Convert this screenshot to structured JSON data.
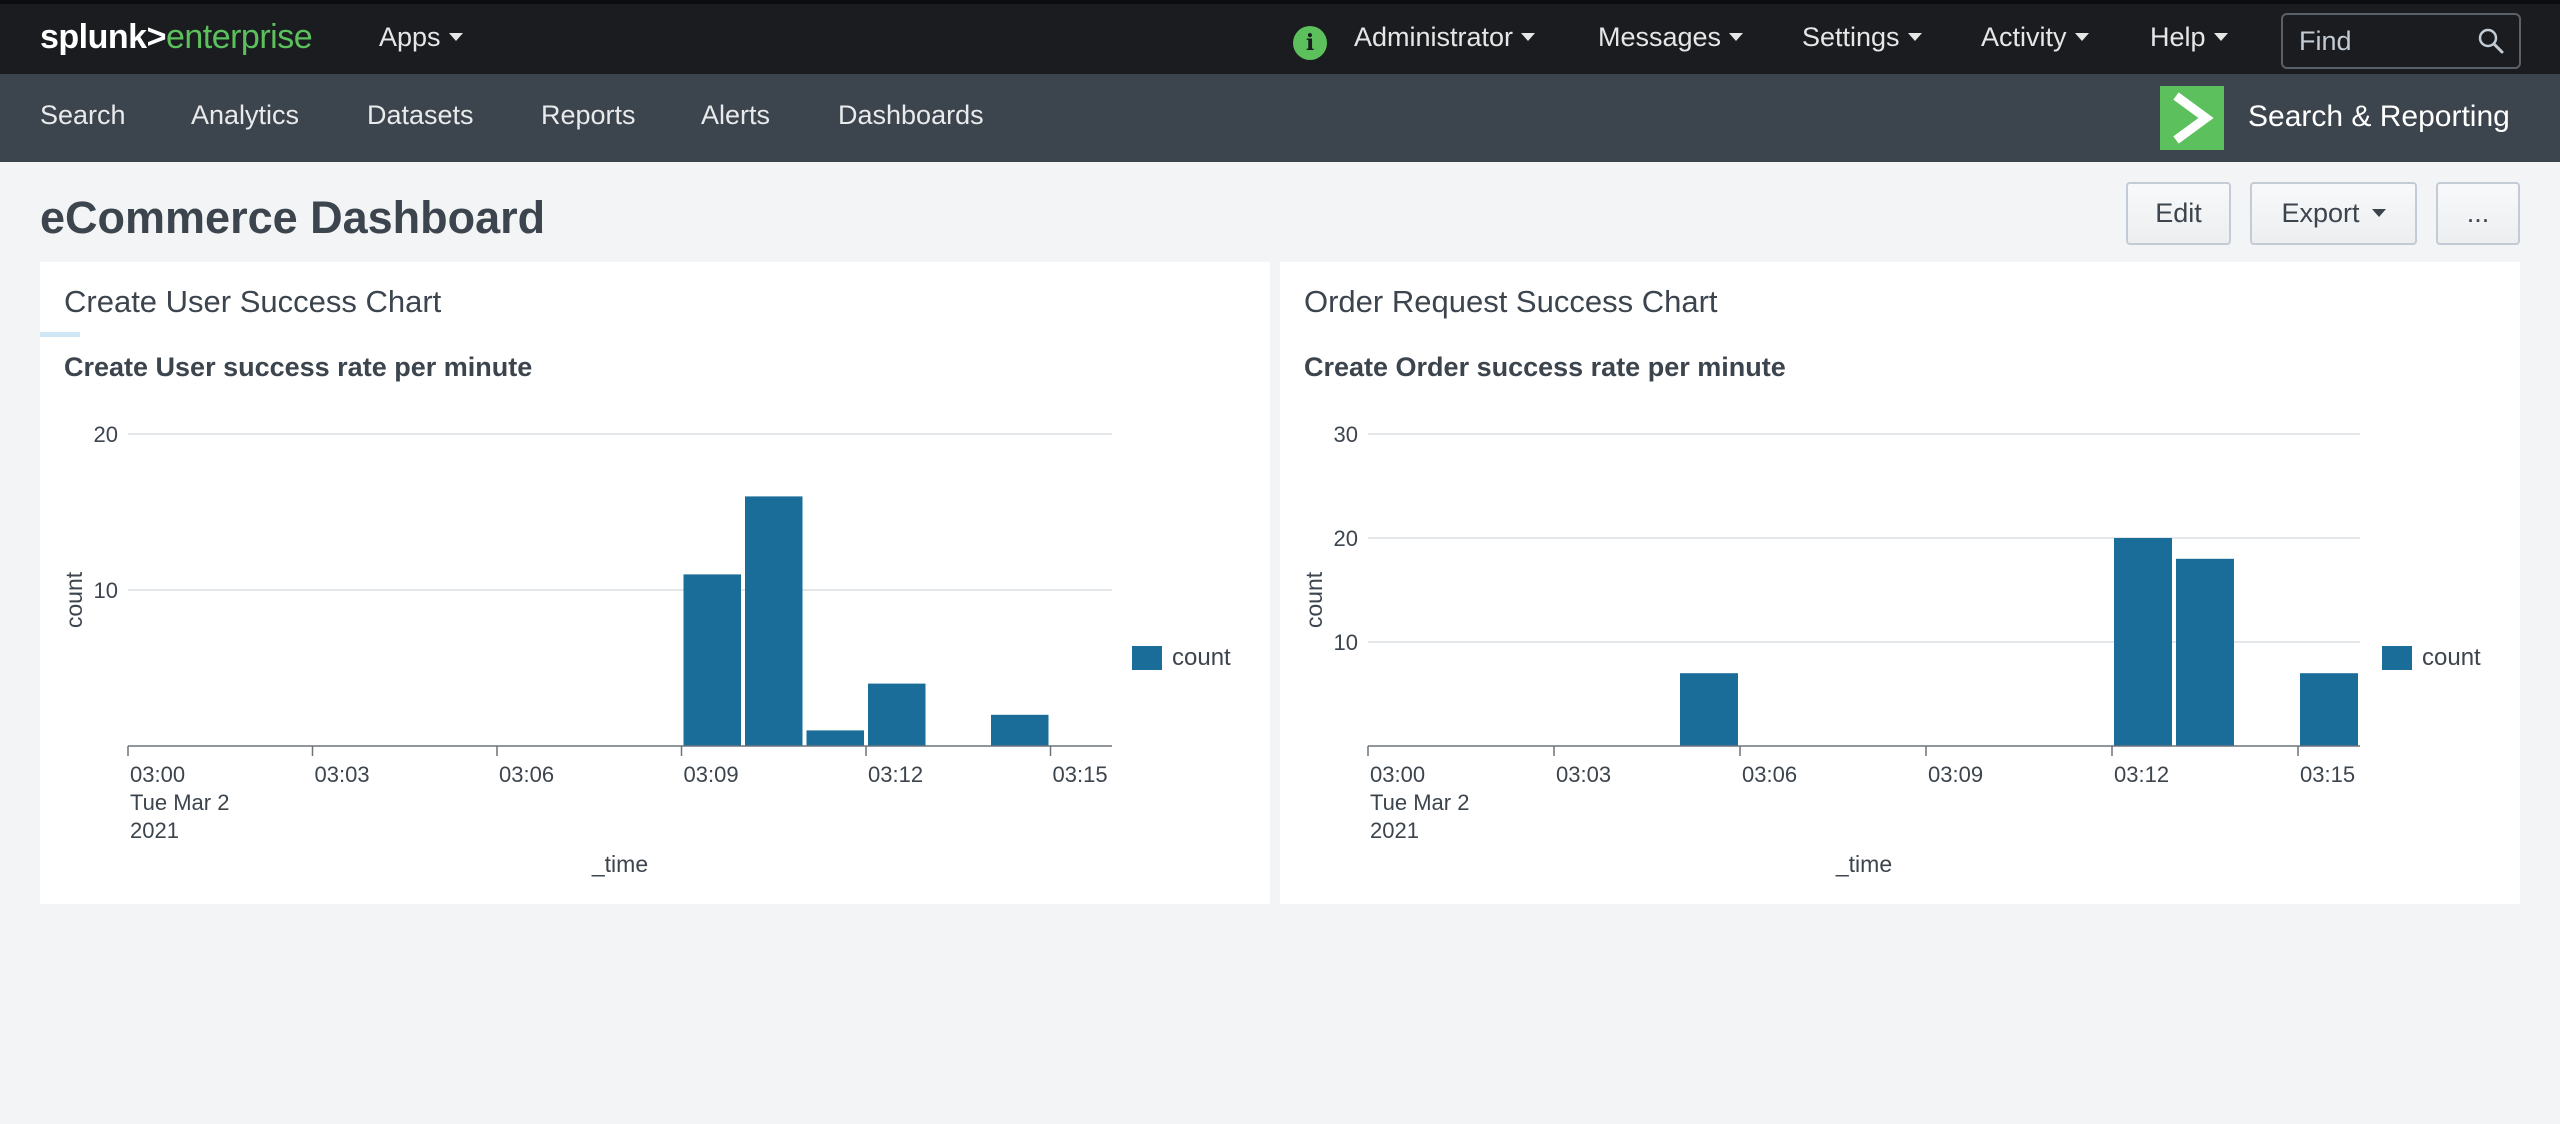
{
  "topbar": {
    "logo_main": "splunk>",
    "logo_sub": "enterprise",
    "apps_label": "Apps",
    "admin_label": "Administrator",
    "messages_label": "Messages",
    "settings_label": "Settings",
    "activity_label": "Activity",
    "help_label": "Help",
    "find_placeholder": "Find",
    "info_icon": "i"
  },
  "appbar": {
    "items": [
      "Search",
      "Analytics",
      "Datasets",
      "Reports",
      "Alerts",
      "Dashboards"
    ],
    "app_title": "Search & Reporting"
  },
  "dashboard": {
    "title": "eCommerce Dashboard",
    "edit_label": "Edit",
    "export_label": "Export",
    "more_label": "..."
  },
  "colors": {
    "bar": "#1a6d99",
    "brand_green": "#5cc05c",
    "grid": "#dcdfe3",
    "axis": "#6b737b"
  },
  "panels": [
    {
      "panel_title": "Create User Success Chart",
      "chart_title": "Create User success rate per minute",
      "legend_label": "count"
    },
    {
      "panel_title": "Order Request Success Chart",
      "chart_title": "Create Order success rate per minute",
      "legend_label": "count"
    }
  ],
  "chart_data": [
    {
      "type": "bar",
      "title": "Create User success rate per minute",
      "xlabel": "_time",
      "ylabel": "count",
      "ylim": [
        0,
        20
      ],
      "yticks": [
        10,
        20
      ],
      "x_range": [
        "03:00",
        "03:16"
      ],
      "xticks": [
        "03:00",
        "03:03",
        "03:06",
        "03:09",
        "03:12",
        "03:15"
      ],
      "first_tick_date": [
        "Tue Mar 2",
        "2021"
      ],
      "grid": true,
      "legend": "right",
      "series": [
        {
          "name": "count",
          "x": [
            "03:09",
            "03:10",
            "03:11",
            "03:12",
            "03:14"
          ],
          "values": [
            11,
            16,
            1,
            4,
            2
          ]
        }
      ]
    },
    {
      "type": "bar",
      "title": "Create Order success rate per minute",
      "xlabel": "_time",
      "ylabel": "count",
      "ylim": [
        0,
        30
      ],
      "yticks": [
        10,
        20,
        30
      ],
      "x_range": [
        "03:00",
        "03:16"
      ],
      "xticks": [
        "03:00",
        "03:03",
        "03:06",
        "03:09",
        "03:12",
        "03:15"
      ],
      "first_tick_date": [
        "Tue Mar 2",
        "2021"
      ],
      "grid": true,
      "legend": "right",
      "series": [
        {
          "name": "count",
          "x": [
            "03:05",
            "03:12",
            "03:13",
            "03:15"
          ],
          "values": [
            7,
            20,
            18,
            7
          ]
        }
      ]
    }
  ]
}
